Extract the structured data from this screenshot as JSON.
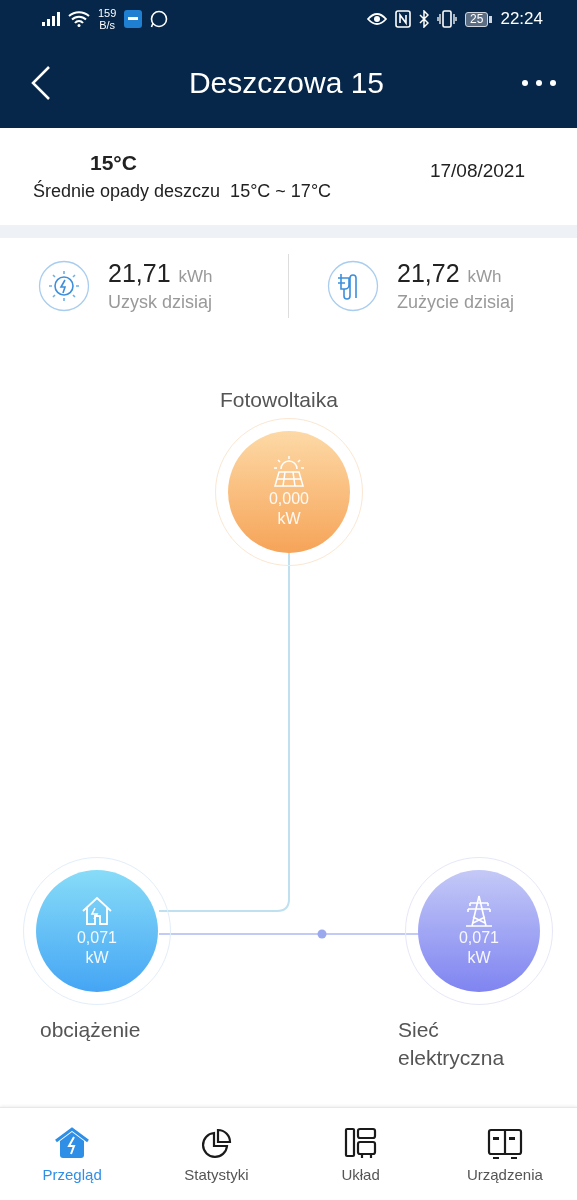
{
  "status_bar": {
    "speed": "159",
    "speed_unit": "B/s",
    "battery": "25",
    "time": "22:24"
  },
  "header": {
    "title": "Deszczowa 15"
  },
  "weather": {
    "temperature": "15°C",
    "description": "Średnie opady deszczu  15°C ~ 17°C",
    "date": "17/08/2021"
  },
  "stats": [
    {
      "kind": "generation",
      "value": "21,71",
      "unit": "kWh",
      "label": "Uzysk dzisiaj"
    },
    {
      "kind": "consumption",
      "value": "21,72",
      "unit": "kWh",
      "label": "Zużycie dzisiaj"
    }
  ],
  "flow": {
    "nodes": [
      {
        "kind": "pv",
        "label": "Fotowoltaika",
        "value": "0,000",
        "unit": "kW"
      },
      {
        "kind": "load",
        "label": "obciążenie",
        "value": "0,071",
        "unit": "kW"
      },
      {
        "kind": "grid",
        "label": "Sieć elektryczna",
        "value": "0,071",
        "unit": "kW"
      }
    ]
  },
  "nav": [
    {
      "kind": "overview",
      "label": "Przegląd",
      "selected": true
    },
    {
      "kind": "stats",
      "label": "Statystyki",
      "selected": false
    },
    {
      "kind": "layout",
      "label": "Układ",
      "selected": false
    },
    {
      "kind": "devices",
      "label": "Urządzenia",
      "selected": false
    }
  ]
}
